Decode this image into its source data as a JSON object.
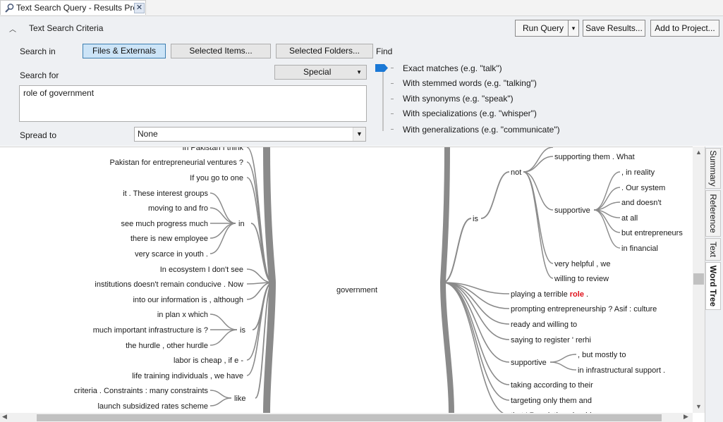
{
  "tab": {
    "title": "Text Search Query - Results Pre",
    "close_label": "✕"
  },
  "criteria": {
    "header": "Text Search Criteria",
    "search_in_label": "Search in",
    "search_in_buttons": [
      "Files & Externals",
      "Selected Items...",
      "Selected Folders..."
    ],
    "search_in_active": "Files & Externals",
    "search_for_label": "Search for",
    "special_label": "Special",
    "search_text": "role of government",
    "spread_to_label": "Spread to",
    "spread_to_value": "None",
    "find_label": "Find",
    "find_options": [
      "Exact matches (e.g. \"talk\")",
      "With stemmed words (e.g. \"talking\")",
      "With synonyms (e.g. \"speak\")",
      "With specializations (e.g. \"whisper\")",
      "With generalizations (e.g. \"communicate\")"
    ],
    "find_level": 0
  },
  "toolbar": {
    "run_query": "Run Query",
    "run_query_arrow": "▾",
    "save_results": "Save Results...",
    "add_to_project": "Add to Project..."
  },
  "side_tabs": [
    "Summary",
    "Reference",
    "Text",
    "Word Tree"
  ],
  "side_tab_active": "Word Tree",
  "colors": {
    "keyword": "#e0101a",
    "branch": "#8a8a8a",
    "accent": "#1a78d6"
  },
  "word_tree": {
    "keyword": "government",
    "left": {
      "leaves": [
        "in Pakistan I think",
        "Pakistan for entrepreneurial ventures ?",
        "If you go to one",
        "In ecosystem I don't see",
        "institutions doesn't remain conducive . Now",
        "into our information is , although",
        "labor is cheap , if e -",
        "life training individuals , we have"
      ],
      "groups": [
        {
          "word": "in",
          "leaves": [
            "it . These interest groups",
            "moving to and fro",
            "see much progress much",
            "there is new employee",
            "very scarce in youth ."
          ]
        },
        {
          "word": "is",
          "leaves": [
            "in plan x which",
            "much important infrastructure is ?",
            "the hurdle , other hurdle"
          ]
        },
        {
          "word": "like",
          "leaves": [
            "criteria . Constraints : many constraints",
            "launch subsidized rates scheme"
          ]
        }
      ]
    },
    "right": {
      "is": {
        "word": "is",
        "not": {
          "word": "not",
          "leaves": [
            "supporting them . What",
            "very helpful , we",
            "willing to review"
          ],
          "supportive": {
            "word": "supportive",
            "leaves": [
              ", in reality",
              ". Our system",
              "and doesn't",
              "at all",
              "but entrepreneurs",
              "in financial"
            ]
          }
        }
      },
      "playing_prefix": "playing a terrible",
      "playing_highlight": "role",
      "playing_suffix": ".",
      "leaves": [
        "prompting entrepreneurship ? Asif : culture",
        "ready and willing to",
        "saying to register ' rerhi",
        "taking according to their",
        "targeting only them and",
        "that ' Regulation should"
      ],
      "supportive2": {
        "word": "supportive",
        "leaves": [
          ", but mostly to",
          "in infrastructural support ."
        ]
      }
    }
  }
}
